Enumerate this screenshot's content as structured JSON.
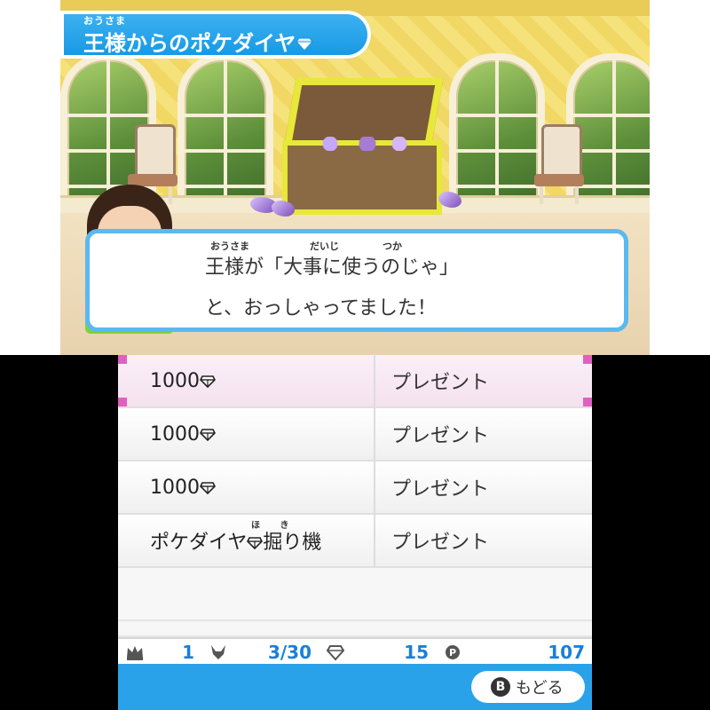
{
  "title": {
    "ruby": "おうさま",
    "text": "王様からのポケダイヤ",
    "icon": "diamond-icon"
  },
  "dialog": {
    "line1_ruby_a": "おうさま",
    "line1_ruby_b": "だいじ",
    "line1_ruby_c": "つか",
    "line1": "王様が「大事に使うのじゃ」",
    "line2": "と、おっしゃってました！"
  },
  "rewards": [
    {
      "item": "1000",
      "icon": "diamond-icon",
      "action": "プレゼント",
      "selected": true
    },
    {
      "item": "1000",
      "icon": "diamond-icon",
      "action": "プレゼント",
      "selected": false
    },
    {
      "item": "1000",
      "icon": "diamond-icon",
      "action": "プレゼント",
      "selected": false
    },
    {
      "item_prefix": "ポケダイヤ",
      "item_suffix": "掘り機",
      "item_ruby": "ほ　 き",
      "icon": "diamond-icon",
      "action": "プレゼント",
      "selected": false
    }
  ],
  "status": {
    "crown_count": "1",
    "pokemon_count": "3/30",
    "diamond_count": "15",
    "points": "107"
  },
  "footer": {
    "back_key": "B",
    "back_label": "もどる"
  },
  "colors": {
    "accent": "#2aa2ea",
    "status_text": "#1a7fd8",
    "selection": "#e060c0"
  }
}
